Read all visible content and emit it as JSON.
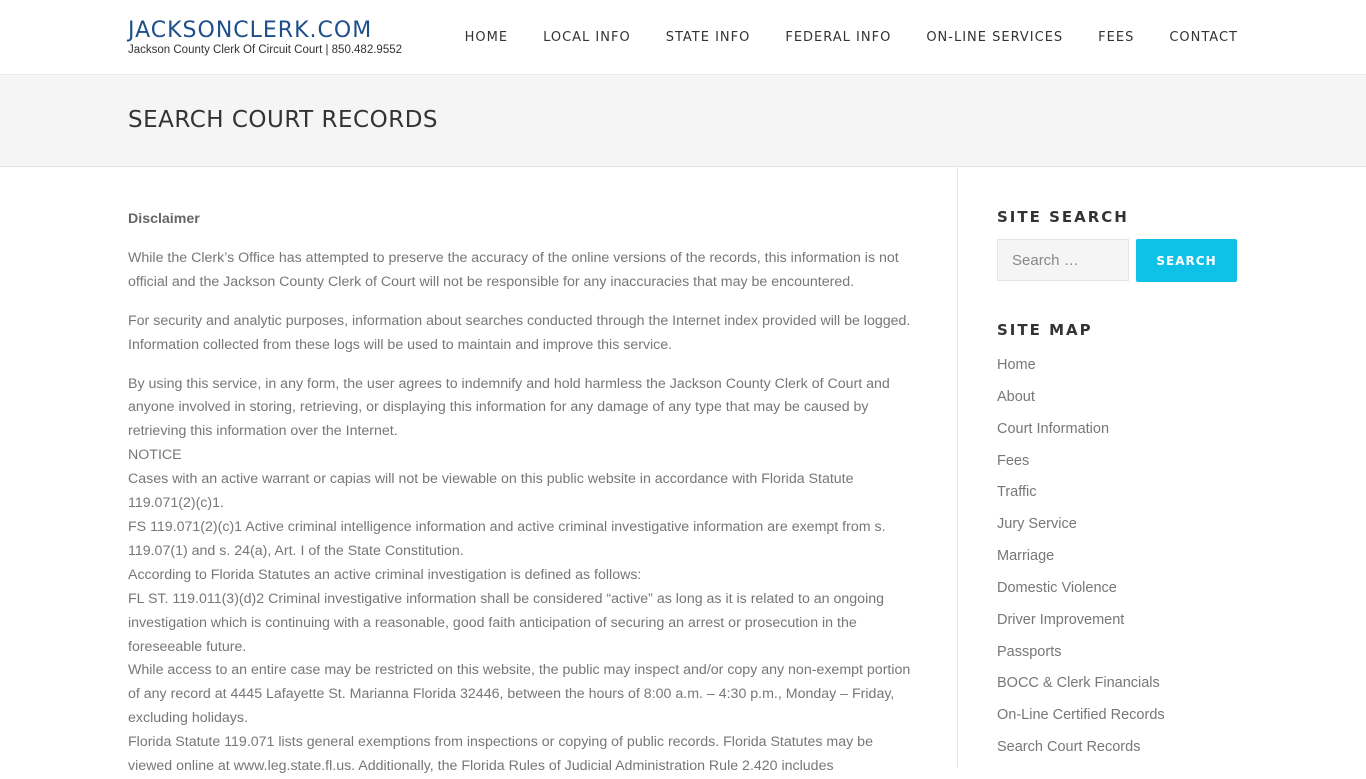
{
  "header": {
    "site_title": "JACKSONCLERK.COM",
    "site_subtitle": "Jackson County Clerk Of Circuit Court | 850.482.9552",
    "nav": [
      "HOME",
      "LOCAL INFO",
      "STATE INFO",
      "FEDERAL INFO",
      "ON-LINE SERVICES",
      "FEES",
      "CONTACT"
    ]
  },
  "page": {
    "title": "SEARCH COURT RECORDS"
  },
  "content": {
    "heading": "Disclaimer",
    "paragraph_1": "While the Clerk’s Office has attempted to preserve the accuracy of the online versions of the records, this information is not official and the Jackson County Clerk of Court will not be responsible for any inaccuracies that may be encountered.",
    "paragraph_2": "For security and analytic purposes, information about searches conducted through the Internet index provided will be logged. Information collected from these logs will be used to maintain and improve this service.",
    "lines": [
      "By using this service, in any form, the user agrees to indemnify and hold harmless the Jackson County Clerk of Court and anyone involved in storing, retrieving, or displaying this information for any damage of any type that may be caused by retrieving this information over the Internet.",
      "NOTICE",
      "Cases with an active warrant or capias will not be viewable on this public website in accordance with Florida Statute 119.071(2)(c)1.",
      "FS 119.071(2)(c)1 Active criminal intelligence information and active criminal investigative information are exempt from s. 119.07(1) and s. 24(a), Art. I of the State Constitution.",
      "According to Florida Statutes an active criminal investigation is defined as follows:",
      "FL ST. 119.011(3)(d)2 Criminal investigative information shall be considered “active” as long as it is related to an ongoing investigation which is continuing with a reasonable, good faith anticipation of securing an arrest or prosecution in the foreseeable future.",
      "While access to an entire case may be restricted on this website, the public may inspect and/or copy any non-exempt portion of any record at 4445 Lafayette St. Marianna Florida 32446, between the hours of 8:00 a.m. – 4:30 p.m., Monday – Friday, excluding holidays.",
      "Florida Statute 119.071 lists general exemptions from inspections or copying of public records. Florida Statutes may be viewed online at www.leg.state.fl.us. Additionally, the Florida Rules of Judicial Administration Rule 2.420 includes"
    ]
  },
  "sidebar": {
    "search_title": "SITE SEARCH",
    "search_placeholder": "Search …",
    "search_button": "SEARCH",
    "sitemap_title": "SITE MAP",
    "sitemap": [
      "Home",
      "About",
      "Court Information",
      "Fees",
      "Traffic",
      "Jury Service",
      "Marriage",
      "Domestic Violence",
      "Driver Improvement",
      "Passports",
      "BOCC & Clerk Financials",
      "On-Line Certified Records",
      "Search Court Records"
    ]
  },
  "colors": {
    "logo": "#1e4f8a",
    "accent_button": "#0fc1e7",
    "title_bar_bg": "#f5f5f5",
    "body_text": "#777777"
  }
}
